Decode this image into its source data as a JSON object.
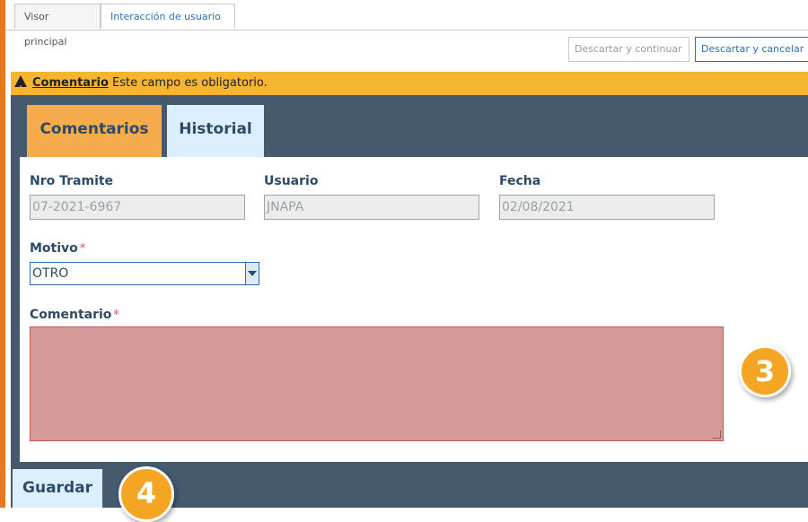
{
  "tabs": [
    {
      "label": "Visor principal",
      "active": false
    },
    {
      "label": "Interacción de usuario",
      "active": true
    }
  ],
  "toolbar": {
    "discard_continue": "Descartar y continuar",
    "discard_cancel": "Descartar y cancelar"
  },
  "warning": {
    "icon": "warning-triangle-icon",
    "field": "Comentario",
    "message": " Este campo es obligatorio."
  },
  "panel_tabs": [
    {
      "label": "Comentarios",
      "active": true
    },
    {
      "label": "Historial",
      "active": false
    }
  ],
  "form": {
    "nro_tramite": {
      "label": "Nro Tramite",
      "value": "07-2021-6967"
    },
    "usuario": {
      "label": "Usuario",
      "value": "JNAPA"
    },
    "fecha": {
      "label": "Fecha",
      "value": "02/08/2021"
    },
    "motivo": {
      "label": "Motivo",
      "required": "*",
      "value": "OTRO"
    },
    "comentario": {
      "label": "Comentario",
      "required": "*",
      "value": ""
    }
  },
  "save_label": "Guardar",
  "step_badges": [
    "3",
    "4"
  ],
  "colors": {
    "accent_orange": "#f6b530",
    "panel_bg": "#455a6d",
    "active_tab": "#f6ab4d",
    "inactive_tab": "#dbefff",
    "error_field": "#d59a99",
    "link_blue": "#2d6fb3"
  }
}
